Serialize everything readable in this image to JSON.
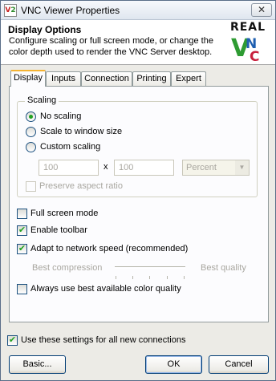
{
  "window": {
    "title": "VNC Viewer Properties",
    "close_glyph": "✕"
  },
  "header": {
    "title": "Display Options",
    "description": "Configure scaling or full screen mode, or change the color depth used to render the VNC Server desktop.",
    "logo_top": "REAL",
    "logo_letters": [
      "V",
      "N",
      "C"
    ],
    "colors": {
      "v": "#2e9b32",
      "n": "#1f5fb0",
      "c": "#c81f3c"
    }
  },
  "tabs": [
    {
      "label": "Display",
      "active": true
    },
    {
      "label": "Inputs",
      "active": false
    },
    {
      "label": "Connection",
      "active": false
    },
    {
      "label": "Printing",
      "active": false
    },
    {
      "label": "Expert",
      "active": false
    }
  ],
  "scaling": {
    "group_label": "Scaling",
    "options": [
      {
        "label": "No scaling",
        "selected": true
      },
      {
        "label": "Scale to window size",
        "selected": false
      },
      {
        "label": "Custom scaling",
        "selected": false
      }
    ],
    "width_value": "100",
    "separator": "x",
    "height_value": "100",
    "unit": "Percent",
    "preserve_label": "Preserve aspect ratio",
    "preserve_checked": false
  },
  "options": {
    "full_screen": {
      "label": "Full screen mode",
      "checked": false
    },
    "toolbar": {
      "label": "Enable toolbar",
      "checked": true
    },
    "adapt": {
      "label": "Adapt to network speed (recommended)",
      "checked": true
    },
    "best_color": {
      "label": "Always use best available color quality",
      "checked": false
    }
  },
  "quality_slider": {
    "left_label": "Best compression",
    "right_label": "Best quality"
  },
  "footer": {
    "use_settings": {
      "label": "Use these settings for all new connections",
      "checked": true
    },
    "basic_label": "Basic...",
    "ok_label": "OK",
    "cancel_label": "Cancel"
  },
  "check_glyph": "✔"
}
